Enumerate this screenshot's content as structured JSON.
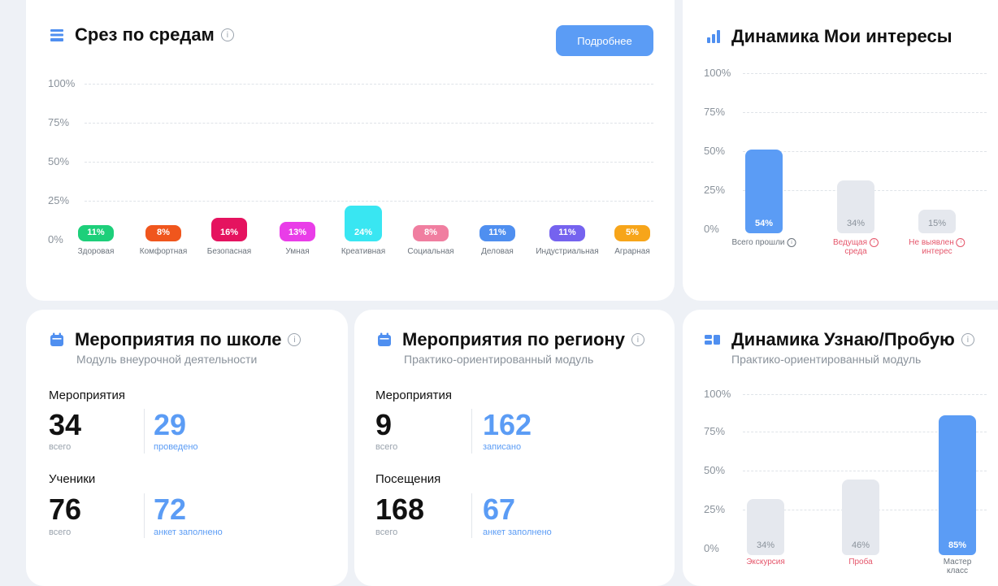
{
  "sreda": {
    "title": "Срез по средам",
    "button": "Подробнее",
    "yticks": [
      "100%",
      "75%",
      "50%",
      "25%",
      "0%"
    ],
    "bars": [
      {
        "label": "Здоровая",
        "value": "11%",
        "color": "#1dcf7a",
        "pct": 11
      },
      {
        "label": "Комфортная",
        "value": "8%",
        "color": "#f0561d",
        "pct": 8
      },
      {
        "label": "Безопасная",
        "value": "16%",
        "color": "#e5135f",
        "pct": 16
      },
      {
        "label": "Умная",
        "value": "13%",
        "color": "#e93de8",
        "pct": 13
      },
      {
        "label": "Креативная",
        "value": "24%",
        "color": "#39e6f2",
        "pct": 24
      },
      {
        "label": "Социальная",
        "value": "8%",
        "color": "#f07ea0",
        "pct": 8
      },
      {
        "label": "Деловая",
        "value": "11%",
        "color": "#4f8ff0",
        "pct": 11
      },
      {
        "label": "Индустриальная",
        "value": "11%",
        "color": "#7563ef",
        "pct": 11
      },
      {
        "label": "Аграрная",
        "value": "5%",
        "color": "#f7a51a",
        "pct": 5
      }
    ]
  },
  "interests": {
    "title": "Динамика Мои интересы",
    "yticks": [
      "100%",
      "75%",
      "50%",
      "25%",
      "0%"
    ],
    "bars": [
      {
        "label": "Всего прошли",
        "value": "54%",
        "pct": 54,
        "style": "blue",
        "label_color": "grey",
        "info": true
      },
      {
        "label": "Ведущая",
        "label2": "среда",
        "value": "34%",
        "pct": 34,
        "style": "grey",
        "label_color": "red",
        "info": true
      },
      {
        "label": "Не выявлен",
        "label2": "интерес",
        "value": "15%",
        "pct": 15,
        "style": "grey",
        "label_color": "red",
        "info": true
      }
    ]
  },
  "school": {
    "title": "Мероприятия по школе",
    "subtitle": "Модуль внеурочной деятельности",
    "events_label": "Мероприятия",
    "events_total": "34",
    "events_total_cap": "всего",
    "events_done": "29",
    "events_done_cap": "проведено",
    "students_label": "Ученики",
    "students_total": "76",
    "students_total_cap": "всего",
    "students_forms": "72",
    "students_forms_cap": "анкет заполнено"
  },
  "region": {
    "title": "Мероприятия по региону",
    "subtitle": "Практико-ориентированный модуль",
    "events_label": "Мероприятия",
    "events_total": "9",
    "events_total_cap": "всего",
    "events_reg": "162",
    "events_reg_cap": "записано",
    "visits_label": "Посещения",
    "visits_total": "168",
    "visits_total_cap": "всего",
    "visits_forms": "67",
    "visits_forms_cap": "анкет заполнено"
  },
  "learn": {
    "title": "Динамика Узнаю/Пробую",
    "subtitle": "Практико-ориентированный модуль",
    "yticks": [
      "100%",
      "75%",
      "50%",
      "25%",
      "0%"
    ],
    "bars": [
      {
        "label": "Экскурсия",
        "value": "34%",
        "pct": 34,
        "style": "grey",
        "label_color": "red"
      },
      {
        "label": "Проба",
        "value": "46%",
        "pct": 46,
        "style": "grey",
        "label_color": "red"
      },
      {
        "label": "Мастер",
        "label2": "класс",
        "value": "85%",
        "pct": 85,
        "style": "blue",
        "label_color": "grey"
      }
    ]
  }
}
